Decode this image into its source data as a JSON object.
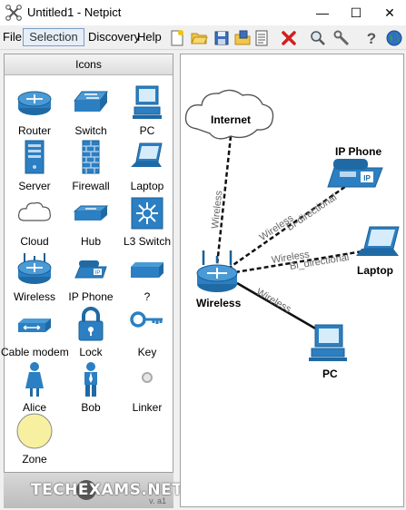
{
  "window": {
    "title": "Untitled1 - Netpict",
    "minimize_glyph": "—",
    "maximize_glyph": "☐",
    "close_glyph": "✕"
  },
  "menu": {
    "file": "File",
    "selection": "Selection",
    "discovery": "Discovery",
    "help": "Help"
  },
  "toolbar": [
    "new-icon",
    "open-folder-icon",
    "save-icon",
    "export-icon",
    "document-icon",
    "delete-icon",
    "zoom-icon",
    "tools-icon",
    "help-icon",
    "globe-icon"
  ],
  "sidebar": {
    "header": "Icons",
    "items": [
      {
        "label": "Router",
        "icon": "router-icon"
      },
      {
        "label": "Switch",
        "icon": "switch-icon"
      },
      {
        "label": "PC",
        "icon": "pc-icon"
      },
      {
        "label": "Server",
        "icon": "server-icon"
      },
      {
        "label": "Firewall",
        "icon": "firewall-icon"
      },
      {
        "label": "Laptop",
        "icon": "laptop-icon"
      },
      {
        "label": "Cloud",
        "icon": "cloud-icon"
      },
      {
        "label": "Hub",
        "icon": "hub-icon"
      },
      {
        "label": "L3 Switch",
        "icon": "l3-switch-icon"
      },
      {
        "label": "Wireless",
        "icon": "wireless-router-icon"
      },
      {
        "label": "IP Phone",
        "icon": "ip-phone-icon"
      },
      {
        "label": "?",
        "icon": "unknown-device-icon"
      },
      {
        "label": "Cable modem",
        "icon": "cable-modem-icon"
      },
      {
        "label": "Lock",
        "icon": "lock-icon"
      },
      {
        "label": "Key",
        "icon": "key-icon"
      },
      {
        "label": "Alice",
        "icon": "alice-person-icon"
      },
      {
        "label": "Bob",
        "icon": "bob-person-icon"
      },
      {
        "label": "Linker",
        "icon": "linker-icon"
      },
      {
        "label": "Zone",
        "icon": "zone-icon"
      }
    ]
  },
  "footer": {
    "logo": "TECHEXAMS.NET",
    "version": "v. a1"
  },
  "diagram": {
    "nodes": {
      "internet": "Internet",
      "ip_phone": "IP Phone",
      "laptop": "Laptop",
      "wireless": "Wireless",
      "pc": "PC",
      "ip_phone_badge": "IP"
    },
    "links": {
      "internet_label": "Wireless",
      "phone_label_1": "Wireless",
      "phone_label_2": "Bi-directional",
      "laptop_label_1": "Wireless",
      "laptop_label_2": "Bi_directional",
      "pc_label": "Wireless"
    }
  }
}
